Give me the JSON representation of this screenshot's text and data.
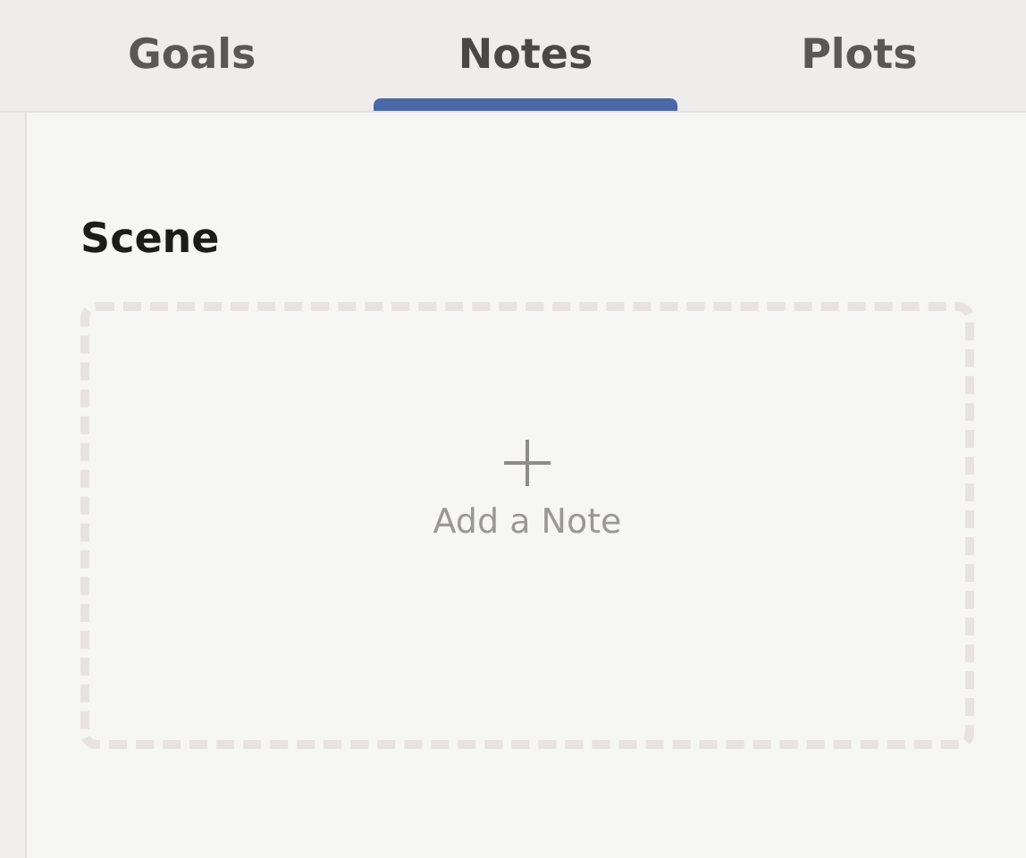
{
  "tabs": [
    {
      "label": "Goals",
      "selected": false
    },
    {
      "label": "Notes",
      "selected": true
    },
    {
      "label": "Plots",
      "selected": false
    }
  ],
  "section": {
    "title": "Scene",
    "add_note": {
      "label": "Add a Note"
    }
  }
}
